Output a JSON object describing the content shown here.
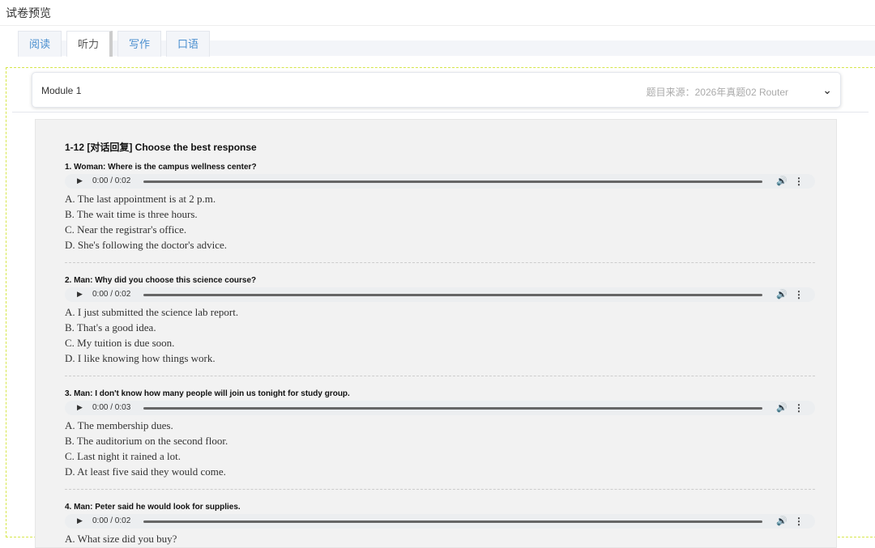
{
  "header": {
    "title": "试卷预览"
  },
  "tabs": [
    {
      "label": "阅读"
    },
    {
      "label": "听力",
      "active": true
    },
    {
      "label": "写作"
    },
    {
      "label": "口语"
    }
  ],
  "module": {
    "name": "Module 1",
    "source": "题目来源：2026年真题02 Router"
  },
  "section": {
    "title": "1-12 [对话回复] Choose the best response"
  },
  "questions": [
    {
      "text": "1. Woman: Where is the campus wellness center?",
      "time": "0:00 / 0:02",
      "options": [
        "A. The last appointment is at 2 p.m.",
        "B. The wait time is three hours.",
        "C. Near the registrar's office.",
        "D. She's following the doctor's advice."
      ]
    },
    {
      "text": "2. Man: Why did you choose this science course?",
      "time": "0:00 / 0:02",
      "options": [
        "A. I just submitted the science lab report.",
        "B. That's a good idea.",
        "C. My tuition is due soon.",
        "D. I like knowing how things work."
      ]
    },
    {
      "text": "3. Man: I don't know how many people will join us tonight for study group.",
      "time": "0:00 / 0:03",
      "options": [
        "A. The membership dues.",
        "B. The auditorium on the second floor.",
        "C. Last night it rained a lot.",
        "D. At least five said they would come."
      ]
    },
    {
      "text": "4. Man: Peter said he would look for supplies.",
      "time": "0:00 / 0:02",
      "options": [
        "A. What size did you buy?"
      ]
    }
  ]
}
